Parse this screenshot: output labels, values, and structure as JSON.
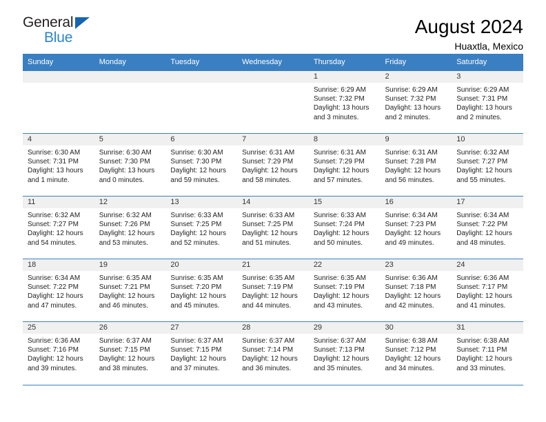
{
  "logo": {
    "word_one": "General",
    "word_two": "Blue",
    "triangle_color": "#1565b0",
    "blue_color": "#2a84d2"
  },
  "header": {
    "title": "August 2024",
    "subtitle": "Huaxtla, Mexico"
  },
  "theme": {
    "header_blue": "#3a7fc1",
    "daynum_band": "#f0f0f0"
  },
  "weekday_headers": [
    "Sunday",
    "Monday",
    "Tuesday",
    "Wednesday",
    "Thursday",
    "Friday",
    "Saturday"
  ],
  "labels": {
    "sunrise_prefix": "Sunrise:",
    "sunset_prefix": "Sunset:",
    "daylight_prefix": "Daylight:"
  },
  "weeks": [
    [
      {
        "day": "",
        "empty": true
      },
      {
        "day": "",
        "empty": true
      },
      {
        "day": "",
        "empty": true
      },
      {
        "day": "",
        "empty": true
      },
      {
        "day": "1",
        "sunrise": "Sunrise: 6:29 AM",
        "sunset": "Sunset: 7:32 PM",
        "daylight_1": "Daylight: 13 hours",
        "daylight_2": "and 3 minutes."
      },
      {
        "day": "2",
        "sunrise": "Sunrise: 6:29 AM",
        "sunset": "Sunset: 7:32 PM",
        "daylight_1": "Daylight: 13 hours",
        "daylight_2": "and 2 minutes."
      },
      {
        "day": "3",
        "sunrise": "Sunrise: 6:29 AM",
        "sunset": "Sunset: 7:31 PM",
        "daylight_1": "Daylight: 13 hours",
        "daylight_2": "and 2 minutes."
      }
    ],
    [
      {
        "day": "4",
        "sunrise": "Sunrise: 6:30 AM",
        "sunset": "Sunset: 7:31 PM",
        "daylight_1": "Daylight: 13 hours",
        "daylight_2": "and 1 minute."
      },
      {
        "day": "5",
        "sunrise": "Sunrise: 6:30 AM",
        "sunset": "Sunset: 7:30 PM",
        "daylight_1": "Daylight: 13 hours",
        "daylight_2": "and 0 minutes."
      },
      {
        "day": "6",
        "sunrise": "Sunrise: 6:30 AM",
        "sunset": "Sunset: 7:30 PM",
        "daylight_1": "Daylight: 12 hours",
        "daylight_2": "and 59 minutes."
      },
      {
        "day": "7",
        "sunrise": "Sunrise: 6:31 AM",
        "sunset": "Sunset: 7:29 PM",
        "daylight_1": "Daylight: 12 hours",
        "daylight_2": "and 58 minutes."
      },
      {
        "day": "8",
        "sunrise": "Sunrise: 6:31 AM",
        "sunset": "Sunset: 7:29 PM",
        "daylight_1": "Daylight: 12 hours",
        "daylight_2": "and 57 minutes."
      },
      {
        "day": "9",
        "sunrise": "Sunrise: 6:31 AM",
        "sunset": "Sunset: 7:28 PM",
        "daylight_1": "Daylight: 12 hours",
        "daylight_2": "and 56 minutes."
      },
      {
        "day": "10",
        "sunrise": "Sunrise: 6:32 AM",
        "sunset": "Sunset: 7:27 PM",
        "daylight_1": "Daylight: 12 hours",
        "daylight_2": "and 55 minutes."
      }
    ],
    [
      {
        "day": "11",
        "sunrise": "Sunrise: 6:32 AM",
        "sunset": "Sunset: 7:27 PM",
        "daylight_1": "Daylight: 12 hours",
        "daylight_2": "and 54 minutes."
      },
      {
        "day": "12",
        "sunrise": "Sunrise: 6:32 AM",
        "sunset": "Sunset: 7:26 PM",
        "daylight_1": "Daylight: 12 hours",
        "daylight_2": "and 53 minutes."
      },
      {
        "day": "13",
        "sunrise": "Sunrise: 6:33 AM",
        "sunset": "Sunset: 7:25 PM",
        "daylight_1": "Daylight: 12 hours",
        "daylight_2": "and 52 minutes."
      },
      {
        "day": "14",
        "sunrise": "Sunrise: 6:33 AM",
        "sunset": "Sunset: 7:25 PM",
        "daylight_1": "Daylight: 12 hours",
        "daylight_2": "and 51 minutes."
      },
      {
        "day": "15",
        "sunrise": "Sunrise: 6:33 AM",
        "sunset": "Sunset: 7:24 PM",
        "daylight_1": "Daylight: 12 hours",
        "daylight_2": "and 50 minutes."
      },
      {
        "day": "16",
        "sunrise": "Sunrise: 6:34 AM",
        "sunset": "Sunset: 7:23 PM",
        "daylight_1": "Daylight: 12 hours",
        "daylight_2": "and 49 minutes."
      },
      {
        "day": "17",
        "sunrise": "Sunrise: 6:34 AM",
        "sunset": "Sunset: 7:22 PM",
        "daylight_1": "Daylight: 12 hours",
        "daylight_2": "and 48 minutes."
      }
    ],
    [
      {
        "day": "18",
        "sunrise": "Sunrise: 6:34 AM",
        "sunset": "Sunset: 7:22 PM",
        "daylight_1": "Daylight: 12 hours",
        "daylight_2": "and 47 minutes."
      },
      {
        "day": "19",
        "sunrise": "Sunrise: 6:35 AM",
        "sunset": "Sunset: 7:21 PM",
        "daylight_1": "Daylight: 12 hours",
        "daylight_2": "and 46 minutes."
      },
      {
        "day": "20",
        "sunrise": "Sunrise: 6:35 AM",
        "sunset": "Sunset: 7:20 PM",
        "daylight_1": "Daylight: 12 hours",
        "daylight_2": "and 45 minutes."
      },
      {
        "day": "21",
        "sunrise": "Sunrise: 6:35 AM",
        "sunset": "Sunset: 7:19 PM",
        "daylight_1": "Daylight: 12 hours",
        "daylight_2": "and 44 minutes."
      },
      {
        "day": "22",
        "sunrise": "Sunrise: 6:35 AM",
        "sunset": "Sunset: 7:19 PM",
        "daylight_1": "Daylight: 12 hours",
        "daylight_2": "and 43 minutes."
      },
      {
        "day": "23",
        "sunrise": "Sunrise: 6:36 AM",
        "sunset": "Sunset: 7:18 PM",
        "daylight_1": "Daylight: 12 hours",
        "daylight_2": "and 42 minutes."
      },
      {
        "day": "24",
        "sunrise": "Sunrise: 6:36 AM",
        "sunset": "Sunset: 7:17 PM",
        "daylight_1": "Daylight: 12 hours",
        "daylight_2": "and 41 minutes."
      }
    ],
    [
      {
        "day": "25",
        "sunrise": "Sunrise: 6:36 AM",
        "sunset": "Sunset: 7:16 PM",
        "daylight_1": "Daylight: 12 hours",
        "daylight_2": "and 39 minutes."
      },
      {
        "day": "26",
        "sunrise": "Sunrise: 6:37 AM",
        "sunset": "Sunset: 7:15 PM",
        "daylight_1": "Daylight: 12 hours",
        "daylight_2": "and 38 minutes."
      },
      {
        "day": "27",
        "sunrise": "Sunrise: 6:37 AM",
        "sunset": "Sunset: 7:15 PM",
        "daylight_1": "Daylight: 12 hours",
        "daylight_2": "and 37 minutes."
      },
      {
        "day": "28",
        "sunrise": "Sunrise: 6:37 AM",
        "sunset": "Sunset: 7:14 PM",
        "daylight_1": "Daylight: 12 hours",
        "daylight_2": "and 36 minutes."
      },
      {
        "day": "29",
        "sunrise": "Sunrise: 6:37 AM",
        "sunset": "Sunset: 7:13 PM",
        "daylight_1": "Daylight: 12 hours",
        "daylight_2": "and 35 minutes."
      },
      {
        "day": "30",
        "sunrise": "Sunrise: 6:38 AM",
        "sunset": "Sunset: 7:12 PM",
        "daylight_1": "Daylight: 12 hours",
        "daylight_2": "and 34 minutes."
      },
      {
        "day": "31",
        "sunrise": "Sunrise: 6:38 AM",
        "sunset": "Sunset: 7:11 PM",
        "daylight_1": "Daylight: 12 hours",
        "daylight_2": "and 33 minutes."
      }
    ]
  ]
}
